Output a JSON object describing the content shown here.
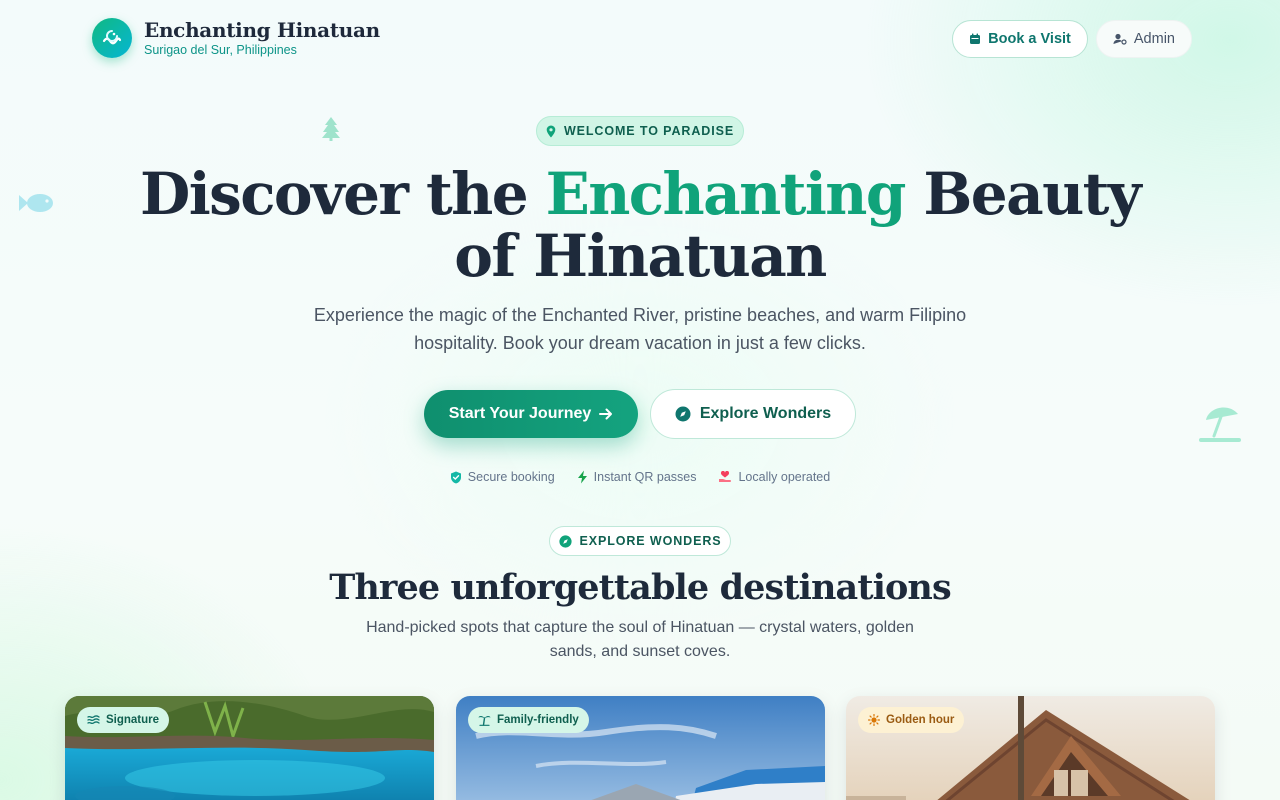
{
  "brand": {
    "title": "Enchanting Hinatuan",
    "subtitle": "Surigao del Sur, Philippines"
  },
  "nav": {
    "book_label": "Book a Visit",
    "admin_label": "Admin"
  },
  "hero": {
    "pill": "WELCOME TO PARADISE",
    "title_before": "Discover the ",
    "title_accent": "Enchanting",
    "title_after": " Beauty of Hinatuan",
    "subtitle": "Experience the magic of the Enchanted River, pristine beaches, and warm Filipino hospitality. Book your dream vacation in just a few clicks.",
    "cta_primary": "Start Your Journey",
    "cta_secondary": "Explore Wonders",
    "trust": [
      {
        "icon": "shield-check-icon",
        "label": "Secure booking"
      },
      {
        "icon": "lightning-icon",
        "label": "Instant QR passes"
      },
      {
        "icon": "heart-hand-icon",
        "label": "Locally operated"
      }
    ]
  },
  "section": {
    "pill": "EXPLORE WONDERS",
    "title": "Three unforgettable destinations",
    "subtitle": "Hand-picked spots that capture the soul of Hinatuan — crystal waters, golden sands, and sunset coves."
  },
  "cards": [
    {
      "badge": "Signature",
      "badge_icon": "waves-icon"
    },
    {
      "badge": "Family-friendly",
      "badge_icon": "palm-tree-icon"
    },
    {
      "badge": "Golden hour",
      "badge_icon": "sun-icon"
    }
  ],
  "colors": {
    "accent": "#10a37a",
    "primary_button": "#0f8f6e",
    "heading": "#1e2a3b",
    "teal_text": "#0d9488"
  }
}
